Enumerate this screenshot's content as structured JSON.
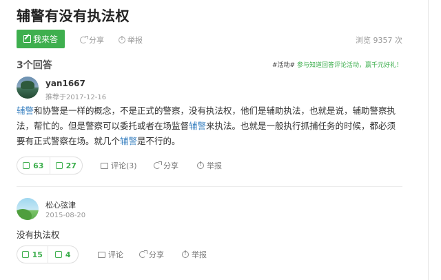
{
  "question": {
    "title": "辅警有没有执法权"
  },
  "actions": {
    "answer_label": "我来答",
    "share_label": "分享",
    "report_label": "举报",
    "views_label": "浏览 9357 次"
  },
  "answers_header": {
    "count_label": "3个回答",
    "activity_tag": "#活动#",
    "activity_text": "参与知道回答评论活动，赢千元好礼！"
  },
  "answers": [
    {
      "username": "yan1667",
      "meta": "推荐于2017-12-16",
      "content": {
        "kw1": "辅警",
        "t1": "和协警是一样的概念，不是正式的警察，没有执法权，他们是辅助执法，也就是说，辅助警察执法，帮忙的。但是警察可以委托或者在场监督",
        "kw2": "辅警",
        "t2": "来执法。也就是一般执行抓捕任务的时候，都必须要有正式警察在场。就几个",
        "kw3": "辅警",
        "t3": "是不行的。"
      },
      "up": "63",
      "down": "27",
      "comment_label": "评论(3)",
      "share_label": "分享",
      "report_label": "举报"
    },
    {
      "username": "松心弦津",
      "meta": "2015-08-20",
      "content": {
        "t1": "没有执法权"
      },
      "up": "15",
      "down": "4",
      "comment_label": "评论",
      "share_label": "分享",
      "report_label": "举报"
    }
  ],
  "colors": {
    "accent_green": "#3eaf4e",
    "link_blue": "#3f84c2"
  }
}
